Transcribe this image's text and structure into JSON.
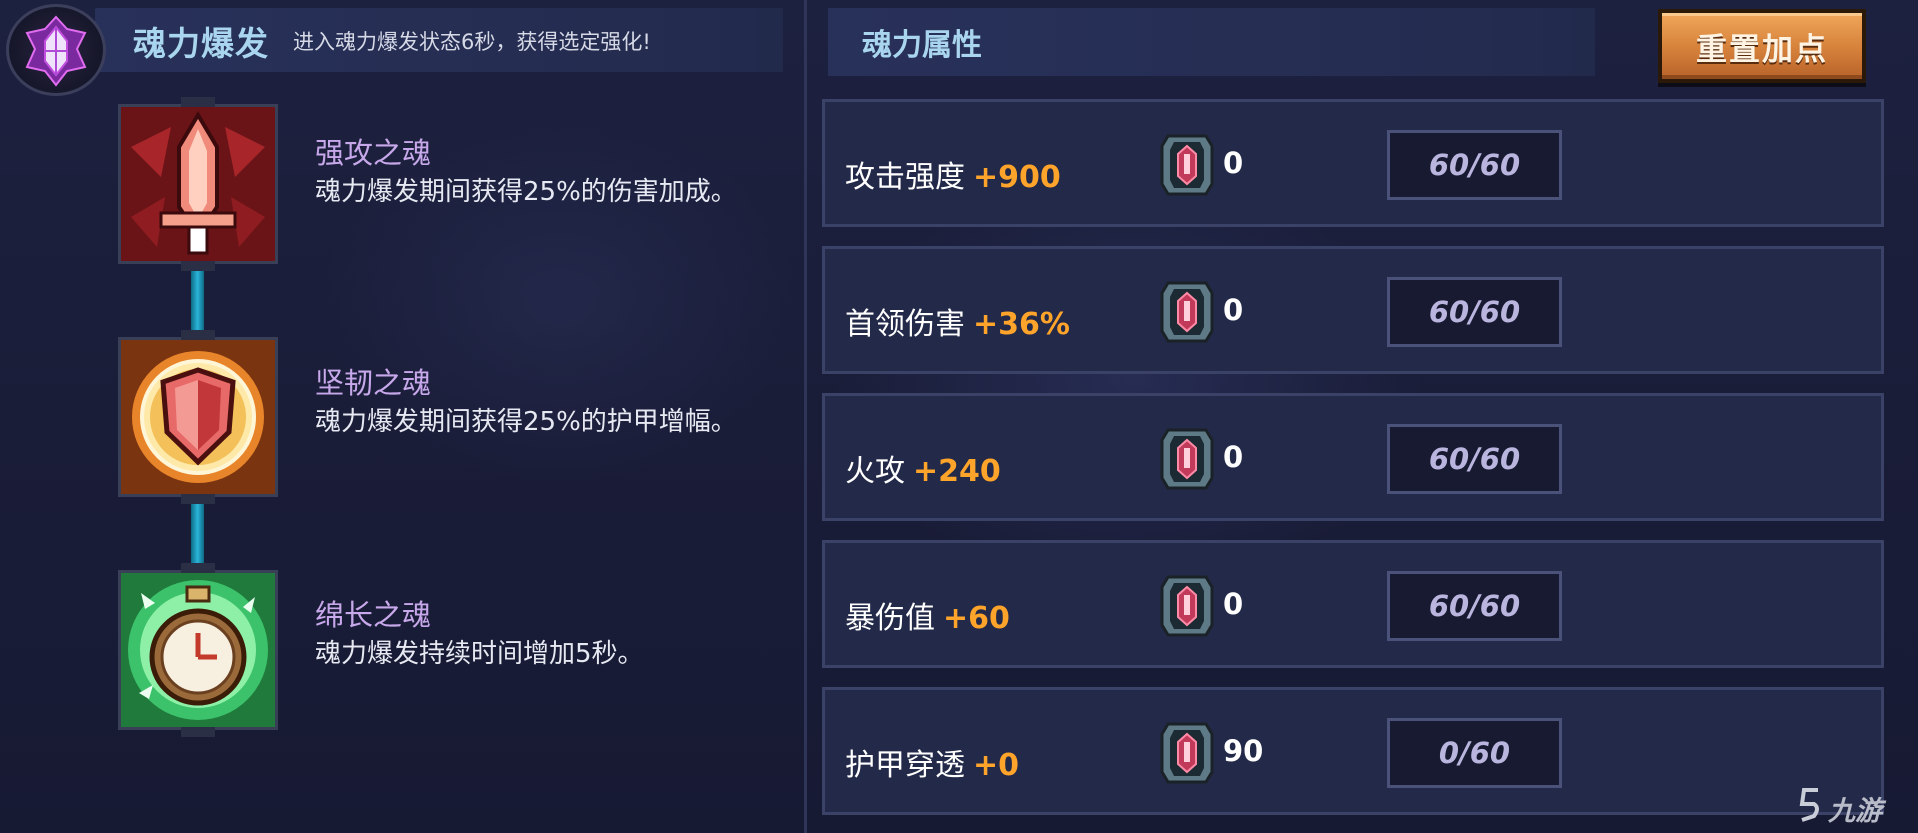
{
  "soul_burst": {
    "title": "魂力爆发",
    "description": "进入魂力爆发状态6秒，获得选定强化!"
  },
  "skills": [
    {
      "name": "强攻之魂",
      "description": "魂力爆发期间获得25%的伤害加成。",
      "icon": "dagger-icon"
    },
    {
      "name": "坚韧之魂",
      "description": "魂力爆发期间获得25%的护甲增幅。",
      "icon": "shield-icon"
    },
    {
      "name": "绵长之魂",
      "description": "魂力爆发持续时间增加5秒。",
      "icon": "stopwatch-icon"
    }
  ],
  "properties": {
    "title": "魂力属性",
    "reset_label": "重置加点",
    "stats": [
      {
        "name": "攻击强度",
        "bonus": "+900",
        "points": "0",
        "progress": "60/60",
        "progress_value": 1.0
      },
      {
        "name": "首领伤害",
        "bonus": "+36%",
        "points": "0",
        "progress": "60/60",
        "progress_value": 1.0
      },
      {
        "name": "火攻",
        "bonus": "+240",
        "points": "0",
        "progress": "60/60",
        "progress_value": 1.0
      },
      {
        "name": "暴伤值",
        "bonus": "+60",
        "points": "0",
        "progress": "60/60",
        "progress_value": 1.0
      },
      {
        "name": "护甲穿透",
        "bonus": "+0",
        "points": "90",
        "progress": "0/60",
        "progress_value": 0.0
      }
    ]
  },
  "watermark": {
    "text": "九游"
  },
  "colors": {
    "accent_title": "#a9d6ee",
    "skill_name": "#c7a8ea",
    "bonus": "#ffa42b",
    "button": "#d5803a",
    "progress_text": "#b9b5de"
  }
}
